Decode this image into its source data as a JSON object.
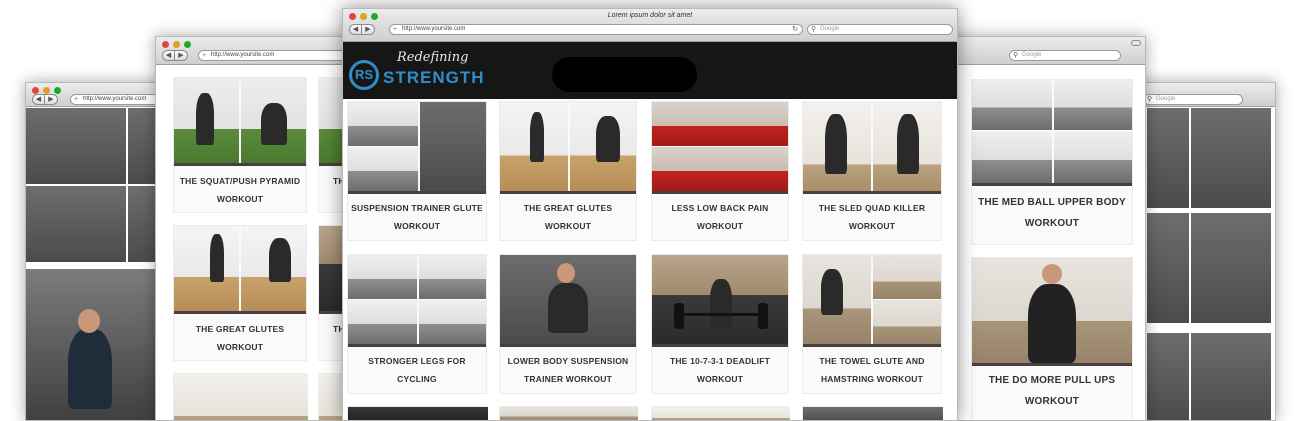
{
  "front": {
    "title": "Lorem ipsum dolor sit amet",
    "url": "http://www.yoursite.com",
    "search_placeholder": "Google",
    "nav_back": "◀",
    "nav_fwd": "▶",
    "reload": "↻",
    "add": "+",
    "logo_initials": "RS",
    "logo_script": "Redefining",
    "logo_word": "STRENGTH",
    "cards": [
      {
        "caption1": "SUSPENSION TRAINER GLUTE",
        "caption2": "WORKOUT"
      },
      {
        "caption1": "THE GREAT GLUTES",
        "caption2": "WORKOUT"
      },
      {
        "caption1": "LESS LOW BACK PAIN",
        "caption2": "WORKOUT"
      },
      {
        "caption1": "THE SLED QUAD KILLER",
        "caption2": "WORKOUT"
      },
      {
        "caption1": "STRONGER LEGS FOR",
        "caption2": "CYCLING"
      },
      {
        "caption1": "LOWER BODY SUSPENSION",
        "caption2": "TRAINER WORKOUT"
      },
      {
        "caption1": "THE 10-7-3-1 DEADLIFT",
        "caption2": "WORKOUT"
      },
      {
        "caption1": "THE TOWEL GLUTE AND",
        "caption2": "HAMSTRING WORKOUT"
      }
    ]
  },
  "back_left": {
    "url": "http://www.yoursite.com",
    "search_placeholder": "Google",
    "cards": [
      {
        "caption1": "THE SQUAT/PUSH PYRAMID",
        "caption2": "WORKOUT",
        "partial": "THI"
      },
      {
        "caption1": "THE GREAT GLUTES",
        "caption2": "WORKOUT",
        "partial": "THI"
      }
    ]
  },
  "back_right": {
    "search_placeholder": "Google",
    "cards": [
      {
        "caption1": "THE MED BALL UPPER BODY",
        "caption2": "WORKOUT"
      },
      {
        "caption1": "THE DO MORE PULL UPS",
        "caption2": "WORKOUT"
      }
    ]
  },
  "far_left": {
    "url": "http://www.yoursite.com"
  },
  "far_right": {
    "search_placeholder": "Google"
  }
}
